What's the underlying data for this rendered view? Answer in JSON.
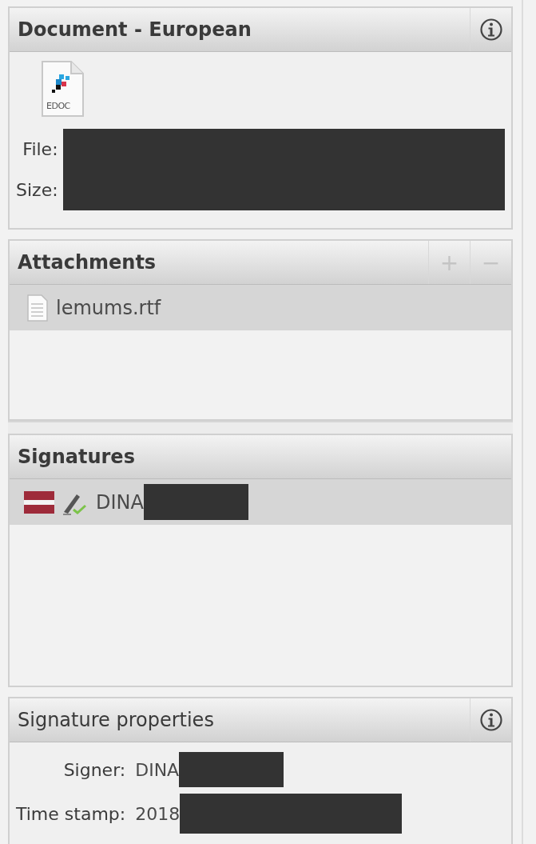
{
  "document_panel": {
    "title": "Document - European",
    "bold_title": true,
    "info_button": true,
    "file_icon_label": "EDOC",
    "fields": [
      {
        "label": "File:",
        "redacted": true
      },
      {
        "label": "Size:",
        "redacted": true
      }
    ]
  },
  "attachments_panel": {
    "title": "Attachments",
    "bold_title": true,
    "buttons": [
      {
        "symbol": "+",
        "disabled": true
      },
      {
        "symbol": "−",
        "disabled": true
      }
    ],
    "items": [
      {
        "name": "lemums.rtf",
        "selected": true
      }
    ]
  },
  "signatures_panel": {
    "title": "Signatures",
    "bold_title": true,
    "items": [
      {
        "name": "DINA",
        "redacted": true,
        "selected": true
      }
    ]
  },
  "signature_properties_panel": {
    "title": "Signature properties",
    "bold_title": false,
    "info_button": true,
    "fields": [
      {
        "label": "Signer:",
        "value": "DINA",
        "redacted": true
      },
      {
        "label": "Time stamp:",
        "value": "2018",
        "redacted": true
      }
    ]
  }
}
